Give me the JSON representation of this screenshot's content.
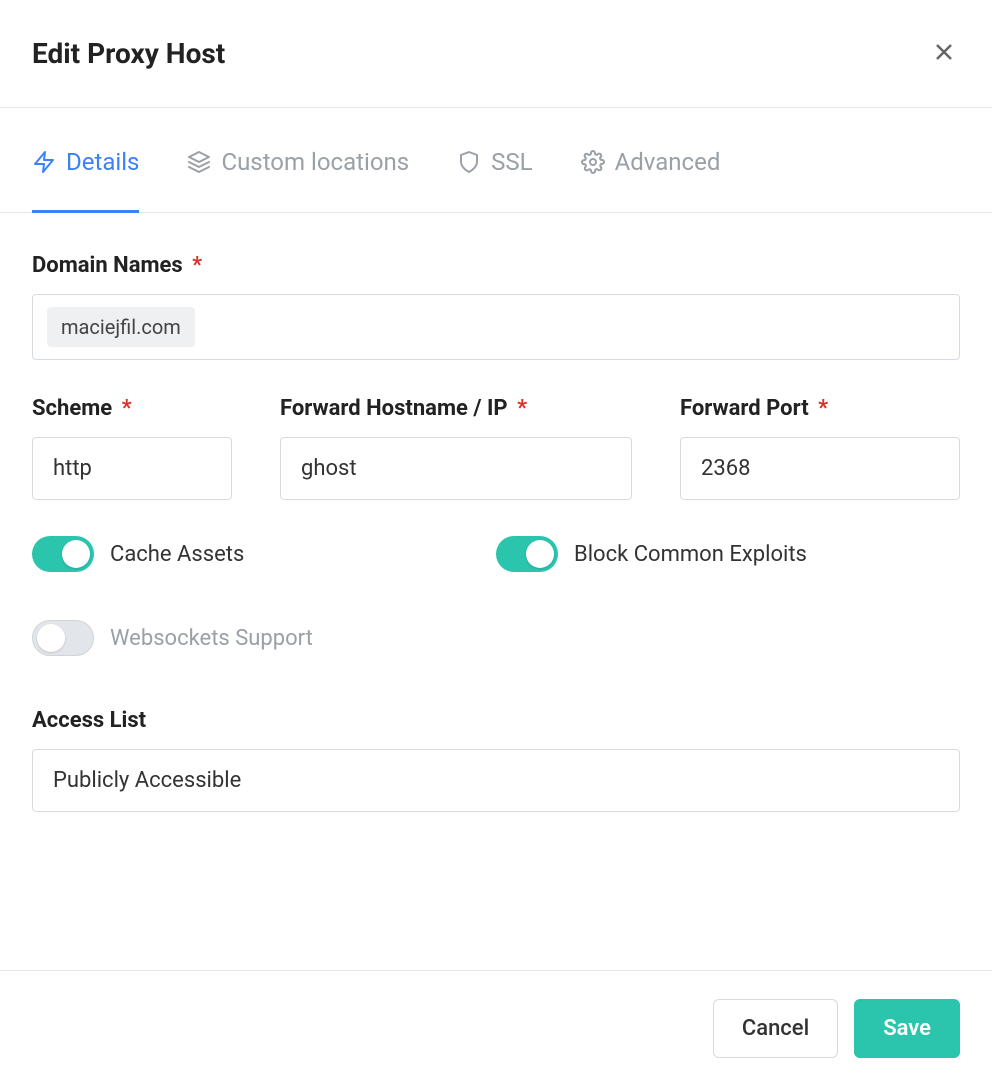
{
  "header": {
    "title": "Edit Proxy Host"
  },
  "tabs": {
    "details": "Details",
    "custom_locations": "Custom locations",
    "ssl": "SSL",
    "advanced": "Advanced"
  },
  "form": {
    "domain_names_label": "Domain Names",
    "domain_chip": "maciejfil.com",
    "scheme_label": "Scheme",
    "scheme_value": "http",
    "forward_host_label": "Forward Hostname / IP",
    "forward_host_value": "ghost",
    "forward_port_label": "Forward Port",
    "forward_port_value": "2368",
    "cache_assets_label": "Cache Assets",
    "block_exploits_label": "Block Common Exploits",
    "websockets_label": "Websockets Support",
    "access_list_label": "Access List",
    "access_list_value": "Publicly Accessible"
  },
  "footer": {
    "cancel": "Cancel",
    "save": "Save"
  },
  "required_mark": "*"
}
